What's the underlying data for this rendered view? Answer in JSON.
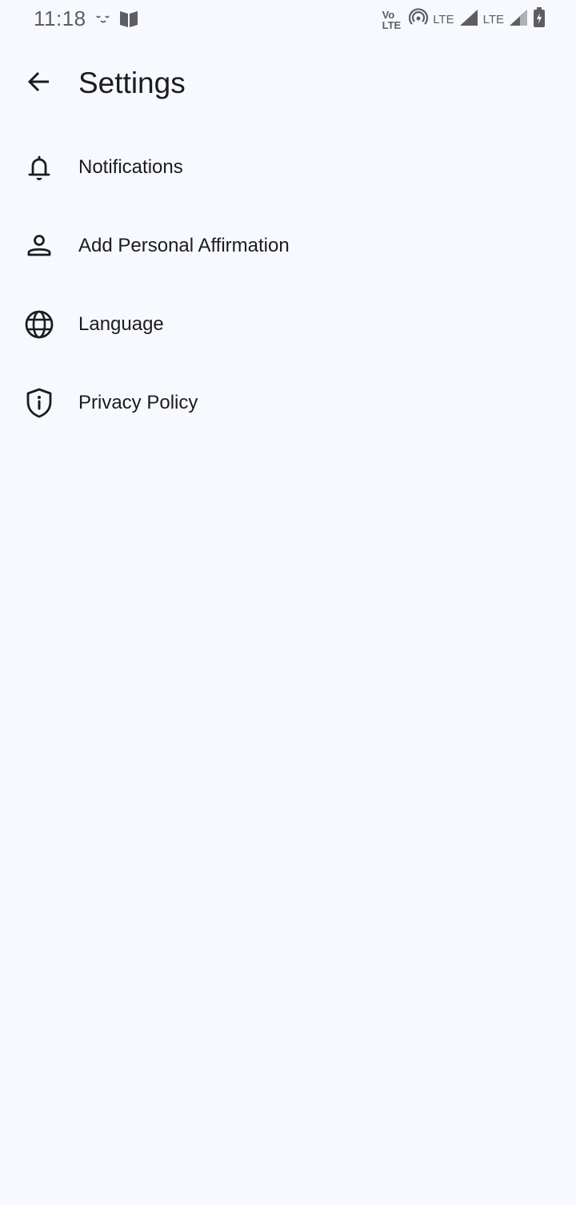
{
  "status_bar": {
    "time": "11:18",
    "volte_top": "Vo",
    "volte_bottom": "LTE",
    "network_1": "LTE",
    "network_2": "LTE"
  },
  "header": {
    "title": "Settings",
    "back_icon": "arrow-back-icon"
  },
  "settings": {
    "items": [
      {
        "label": "Notifications",
        "icon": "bell-icon"
      },
      {
        "label": "Add Personal Affirmation",
        "icon": "person-icon"
      },
      {
        "label": "Language",
        "icon": "globe-icon"
      },
      {
        "label": "Privacy Policy",
        "icon": "shield-info-icon"
      }
    ]
  },
  "colors": {
    "background": "#f7f9fe",
    "text": "#1b1c20",
    "status": "#5d5e63"
  }
}
